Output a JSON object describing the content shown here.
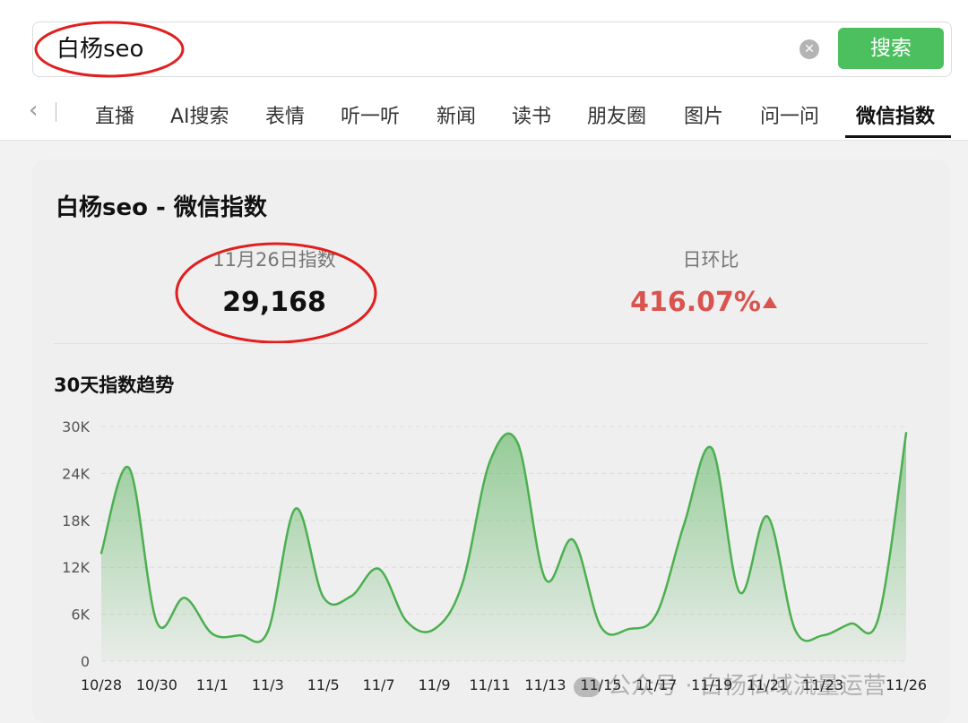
{
  "search": {
    "query": "白杨seo",
    "clear_icon": "close-circle-icon",
    "button_label": "搜索",
    "button_color": "#4cbf5e"
  },
  "tabs": {
    "back_icon": "chevron-left-icon",
    "items": [
      "直播",
      "AI搜索",
      "表情",
      "听一听",
      "新闻",
      "读书",
      "朋友圈",
      "图片",
      "问一问",
      "微信指数"
    ],
    "active": "微信指数"
  },
  "card": {
    "title": "白杨seo - 微信指数",
    "daily": {
      "label": "11月26日指数",
      "value": "29,168"
    },
    "ratio": {
      "label": "日环比",
      "value": "416.07%",
      "color": "#d9534f",
      "trend_icon": "triangle-up-icon"
    },
    "trend_title": "30天指数趋势"
  },
  "chart_data": {
    "type": "area",
    "title": "",
    "xlabel": "",
    "ylabel": "",
    "ylim": [
      0,
      30000
    ],
    "yticks": [
      "0",
      "6K",
      "12K",
      "18K",
      "24K",
      "30K"
    ],
    "xticks": [
      "10/28",
      "10/30",
      "11/1",
      "11/3",
      "11/5",
      "11/7",
      "11/9",
      "11/11",
      "11/13",
      "11/15",
      "11/17",
      "11/19",
      "11/21",
      "11/23",
      "11/26"
    ],
    "x": [
      "10/28",
      "10/29",
      "10/30",
      "10/31",
      "11/1",
      "11/2",
      "11/3",
      "11/4",
      "11/5",
      "11/6",
      "11/7",
      "11/8",
      "11/9",
      "11/10",
      "11/11",
      "11/12",
      "11/13",
      "11/14",
      "11/15",
      "11/16",
      "11/17",
      "11/18",
      "11/19",
      "11/20",
      "11/21",
      "11/22",
      "11/23",
      "11/24",
      "11/25",
      "11/26"
    ],
    "values": [
      13800,
      24700,
      5000,
      8100,
      3500,
      3300,
      3800,
      19500,
      8200,
      8300,
      11800,
      5100,
      4100,
      9800,
      25500,
      27900,
      10500,
      15500,
      4400,
      4100,
      6000,
      17500,
      27200,
      8800,
      18500,
      4000,
      3300,
      4800,
      5500,
      29168
    ],
    "line_color": "#4caf50",
    "grid": true
  },
  "watermark": "公众号 · 白杨私域流量运营"
}
